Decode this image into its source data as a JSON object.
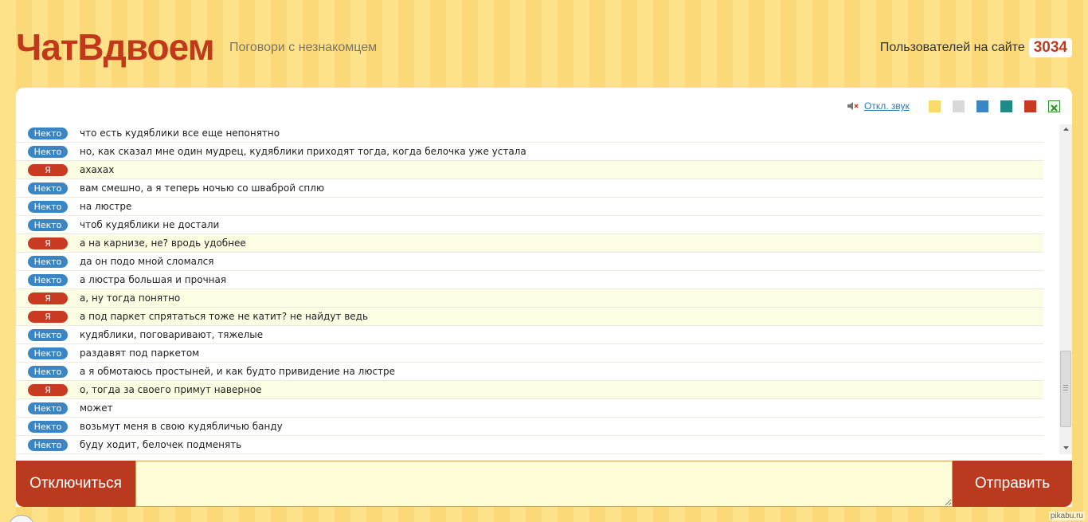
{
  "header": {
    "logo": "ЧатВдвоем",
    "tagline": "Поговори с незнакомцем",
    "users_label": "Пользователей на сайте",
    "users_count": "3034"
  },
  "toolbar": {
    "sound_icon": "speaker-muted-icon",
    "sound_label": "Откл. звук",
    "themes": [
      {
        "name": "yellow",
        "color": "#f9da6b"
      },
      {
        "name": "gray",
        "color": "#d9d9d9"
      },
      {
        "name": "blue",
        "color": "#3a86c4"
      },
      {
        "name": "teal",
        "color": "#1f8a8a"
      },
      {
        "name": "red",
        "color": "#c83a22"
      }
    ],
    "export_icon": "excel-icon"
  },
  "labels": {
    "someone": "Некто",
    "me": "Я"
  },
  "messages": [
    {
      "from": "someone",
      "text": "что есть кудяблики все еще непонятно"
    },
    {
      "from": "someone",
      "text": "но, как сказал мне один мудрец, кудяблики приходят тогда, когда белочка уже устала"
    },
    {
      "from": "me",
      "text": "ахахах"
    },
    {
      "from": "someone",
      "text": "вам смешно, а я теперь ночью со шваброй сплю"
    },
    {
      "from": "someone",
      "text": "на люстре"
    },
    {
      "from": "someone",
      "text": "чтоб кудяблики не достали"
    },
    {
      "from": "me",
      "text": "а на карнизе, не? вродь удобнее"
    },
    {
      "from": "someone",
      "text": "да он подо мной сломался"
    },
    {
      "from": "someone",
      "text": "а люстра большая и прочная"
    },
    {
      "from": "me",
      "text": "а, ну тогда понятно"
    },
    {
      "from": "me",
      "text": "а под паркет спрятаться тоже не катит? не найдут ведь"
    },
    {
      "from": "someone",
      "text": "кудяблики, поговаривают, тяжелые"
    },
    {
      "from": "someone",
      "text": "раздавят под паркетом"
    },
    {
      "from": "someone",
      "text": "а я обмотаюсь простыней, и как будто привидение на люстре"
    },
    {
      "from": "me",
      "text": "о, тогда за своего примут наверное"
    },
    {
      "from": "someone",
      "text": "может"
    },
    {
      "from": "someone",
      "text": "возьмут меня в свою кудябличью банду"
    },
    {
      "from": "someone",
      "text": "буду ходит, белочек подменять"
    }
  ],
  "footer": {
    "disconnect_label": "Отключиться",
    "send_label": "Отправить",
    "input_value": "",
    "watermark": "pikabu.ru"
  }
}
